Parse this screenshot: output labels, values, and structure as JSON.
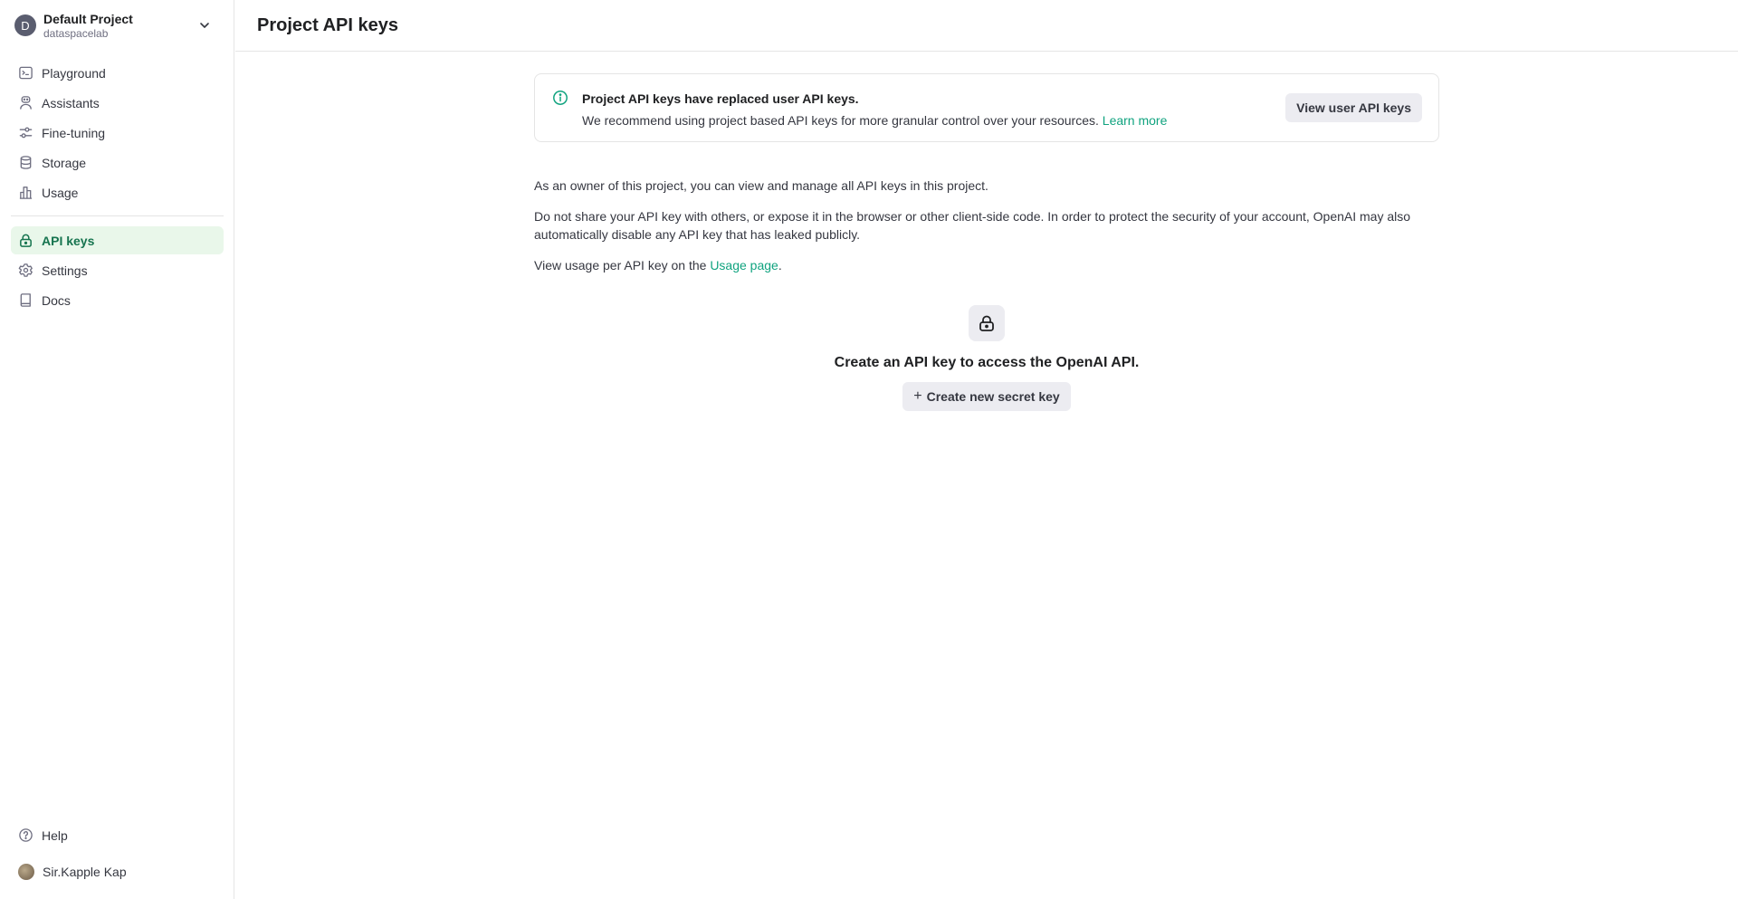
{
  "project": {
    "initial": "D",
    "name": "Default Project",
    "org": "dataspacelab"
  },
  "sidebar": {
    "items": [
      {
        "label": "Playground",
        "icon": "terminal-icon"
      },
      {
        "label": "Assistants",
        "icon": "assistant-icon"
      },
      {
        "label": "Fine-tuning",
        "icon": "sliders-icon"
      },
      {
        "label": "Storage",
        "icon": "database-icon"
      },
      {
        "label": "Usage",
        "icon": "bar-chart-icon"
      }
    ],
    "items2": [
      {
        "label": "API keys",
        "icon": "lock-icon",
        "active": true
      },
      {
        "label": "Settings",
        "icon": "gear-icon"
      },
      {
        "label": "Docs",
        "icon": "book-icon"
      }
    ],
    "bottom": {
      "help": "Help",
      "user": "Sir.Kapple Kap"
    }
  },
  "header": {
    "title": "Project API keys"
  },
  "banner": {
    "title": "Project API keys have replaced user API keys.",
    "description": "We recommend using project based API keys for more granular control over your resources.",
    "link": "Learn more",
    "button": "View user API keys"
  },
  "body": {
    "p1": "As an owner of this project, you can view and manage all API keys in this project.",
    "p2": "Do not share your API key with others, or expose it in the browser or other client-side code. In order to protect the security of your account, OpenAI may also automatically disable any API key that has leaked publicly.",
    "p3_prefix": "View usage per API key on the ",
    "p3_link": "Usage page",
    "p3_suffix": "."
  },
  "empty_state": {
    "text": "Create an API key to access the OpenAI API.",
    "button": "Create new secret key"
  },
  "colors": {
    "accent": "#10a37f",
    "active_bg": "#e9f7ea",
    "active_text": "#16744f"
  }
}
